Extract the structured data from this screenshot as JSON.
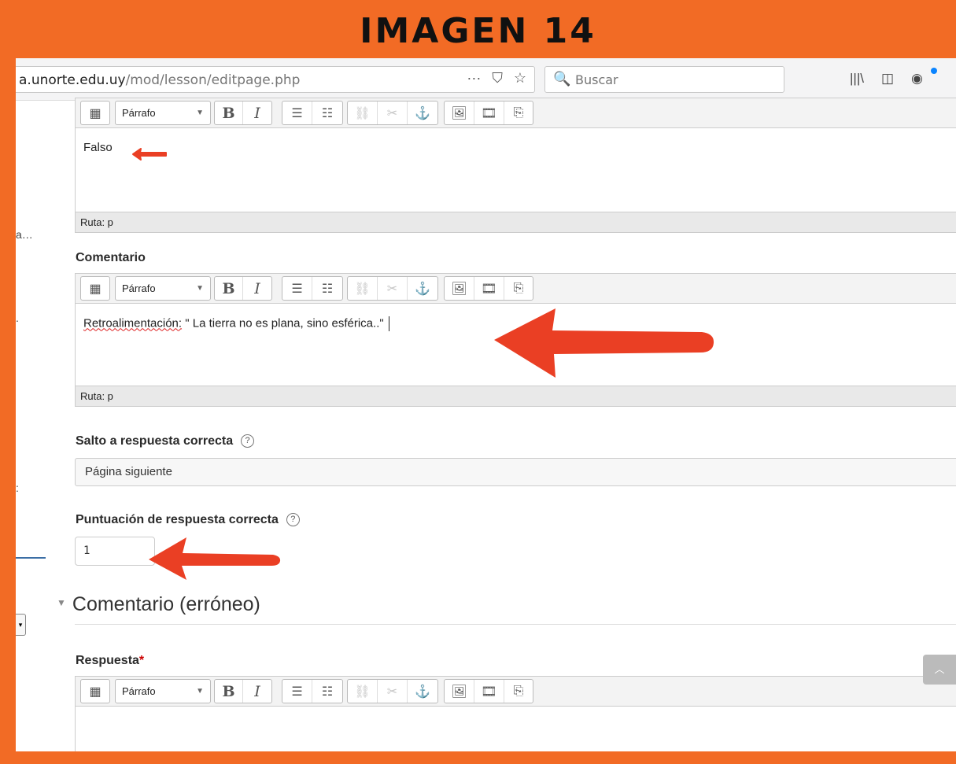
{
  "banner": {
    "title": "IMAGEN 14"
  },
  "browser": {
    "url_domain": "a.unorte.edu.uy",
    "url_path": "/mod/lesson/editpage.php",
    "url_more_icon": "···",
    "pocket_icon": "⛉",
    "bookmark_icon": "☆",
    "search_placeholder": "Buscar",
    "search_icon": "🔍",
    "library_icon": "|||\\",
    "sidebar_icon": "◫",
    "profile_icon": "◉"
  },
  "left_sidebar": {
    "fragment_1": "a…",
    "fragment_2": ".",
    "fragment_3": ":"
  },
  "editor_toolbar": {
    "paragraph_label": "Párrafo",
    "dropdown_caret": "▼",
    "bold": "B",
    "italic": "I",
    "bullet_list_icon": "☰",
    "numbered_list_icon": "☷",
    "link_icon": "⛓",
    "unlink_icon": "✂",
    "anchor_icon": "⚓",
    "image_icon": "🖼",
    "media_icon": "🎞",
    "manage_files_icon": "⎘",
    "toggle_icon": "▦"
  },
  "answer_editor": {
    "content": "Falso",
    "path": "Ruta: p"
  },
  "feedback": {
    "label": "Comentario",
    "content": " \" La tierra no es plana, sino esférica..\"",
    "misspelled_word": "Retroalimentación:",
    "path": "Ruta: p"
  },
  "jump": {
    "label": "Salto a respuesta correcta",
    "value": "Página siguiente",
    "help": "?"
  },
  "score": {
    "label": "Puntuación de respuesta correcta",
    "value": "1",
    "help": "?"
  },
  "wrong_section": {
    "title": "Comentario (erróneo)",
    "toggle_icon": "▼"
  },
  "wrong_answer": {
    "label": "Respuesta",
    "required_marker": "*"
  },
  "back_to_top": {
    "icon": "︿"
  },
  "accent_colors": {
    "banner": "#f26b25",
    "arrow": "#ea3f24",
    "required": "#cc0000"
  }
}
